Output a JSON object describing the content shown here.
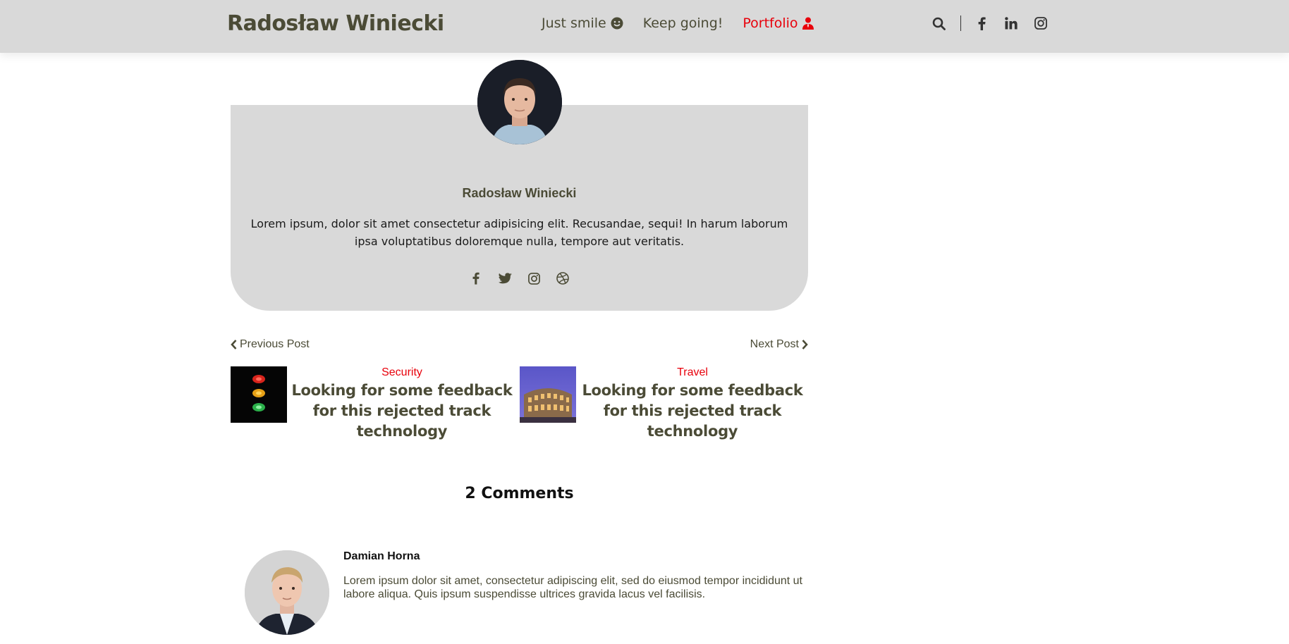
{
  "header": {
    "brand": "Radosław Winiecki",
    "nav": [
      {
        "label": "Just smile",
        "icon": "smile-icon",
        "active": false
      },
      {
        "label": "Keep going!",
        "icon": "",
        "active": false
      },
      {
        "label": "Portfolio",
        "icon": "user-tie-icon",
        "active": true
      }
    ],
    "icons": [
      "search-icon",
      "facebook-icon",
      "linkedin-icon",
      "instagram-icon"
    ]
  },
  "author": {
    "name": "Radosław Winiecki",
    "bio": "Lorem ipsum, dolor sit amet consectetur adipisicing elit. Recusandae, sequi! In harum laborum ipsa voluptatibus doloremque nulla, tempore aut veritatis.",
    "social_icons": [
      "facebook-icon",
      "twitter-icon",
      "instagram-icon",
      "dribbble-icon"
    ]
  },
  "post_nav": {
    "prev_label": "Previous Post",
    "next_label": "Next Post",
    "prev": {
      "category": "Security",
      "title": "Looking for some feedback for this rejected track technology"
    },
    "next": {
      "category": "Travel",
      "title": "Looking for some feedback for this rejected track technology"
    }
  },
  "comments": {
    "heading": "2 Comments",
    "items": [
      {
        "author": "Damian Horna",
        "text": "Lorem ipsum dolor sit amet, consectetur adipiscing elit, sed do eiusmod tempor incididunt ut labore aliqua. Quis ipsum suspendisse ultrices gravida lacus vel facilisis."
      }
    ]
  },
  "colors": {
    "accent": "#e8000b",
    "header_bg": "#d9d9d9",
    "text_dark": "#4b4b36"
  }
}
